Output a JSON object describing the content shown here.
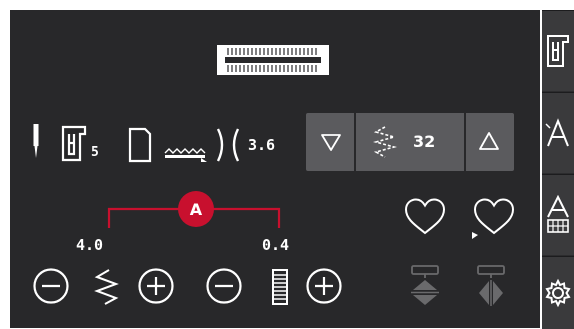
{
  "stitch_info": {
    "presser_foot_number": "5",
    "stitch_balance_value": "3.6"
  },
  "stitch_selection": {
    "stitch_number": "32"
  },
  "stitch_width": {
    "value": "4.0"
  },
  "stitch_length": {
    "value": "0.4"
  },
  "callout": {
    "label": "A"
  },
  "sidebar": {
    "items": [
      {
        "icon": "presser-foot-icon"
      },
      {
        "icon": "font-a-icon"
      },
      {
        "icon": "font-edit-icon"
      },
      {
        "icon": "gear-icon"
      }
    ]
  },
  "colors": {
    "screen_bg": "#28282a",
    "selection_bg": "#5b5b5e",
    "accent_red": "#c8102e",
    "icon_white": "#ffffff",
    "disabled_icon": "#6a6a6c"
  }
}
